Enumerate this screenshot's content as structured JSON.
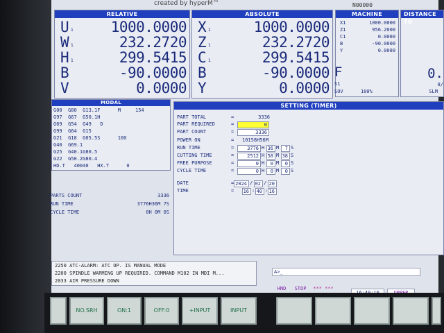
{
  "header": {
    "created_by": "created by hyperM™",
    "program_number": "N00000"
  },
  "relative": {
    "title": "RELATIVE",
    "axes": [
      {
        "axis": "U",
        "sub": "1",
        "value": "1000.0000"
      },
      {
        "axis": "W",
        "sub": "1",
        "value": "232.2720"
      },
      {
        "axis": "H",
        "sub": "1",
        "value": "299.5415"
      },
      {
        "axis": "B",
        "sub": "",
        "value": "-90.0000"
      },
      {
        "axis": "V",
        "sub": "",
        "value": "0.0000"
      }
    ]
  },
  "absolute": {
    "title": "ABSOLUTE",
    "axes": [
      {
        "axis": "X",
        "sub": "1",
        "value": "1000.0000"
      },
      {
        "axis": "Z",
        "sub": "1",
        "value": "232.2720"
      },
      {
        "axis": "C",
        "sub": "1",
        "value": "299.5415"
      },
      {
        "axis": "B",
        "sub": "",
        "value": "-90.0000"
      },
      {
        "axis": "Y",
        "sub": "",
        "value": "0.0000"
      }
    ]
  },
  "machine": {
    "title": "MACHINE",
    "rows": [
      {
        "axis": "X1",
        "value": "1000.0000"
      },
      {
        "axis": "Z1",
        "value": "956.2000"
      },
      {
        "axis": "C1",
        "value": "0.0000"
      },
      {
        "axis": "B",
        "value": "-90.0000"
      },
      {
        "axis": "Y",
        "value": "0.0000"
      }
    ],
    "feed_label": "F",
    "s1_label": "S1",
    "sov_label": "SOV",
    "sov_value": "100%"
  },
  "distance": {
    "title": "DISTANCE TO",
    "value": "0.",
    "sub": "8/",
    "slm": "SLM"
  },
  "modal": {
    "title": "MODAL",
    "lines": [
      "G00  G80  G13.1F      M     154",
      "G97  G67  G50.1H",
      "G69  G54  G49   D",
      "G99  G64  G15",
      "G21  G18  G05.5S      100",
      "G40  G69.1",
      "G25  G40.1G80.5",
      "G22  G50.2G80.4",
      "HD.T   40040   HX.T      0"
    ]
  },
  "summary": {
    "parts_count_label": "PARTS COUNT",
    "parts_count_value": "3336",
    "run_time_label": "RUN TIME",
    "run_time_value": "3776H36M 7S",
    "cycle_time_label": "CYCLE TIME",
    "cycle_time_value": "0H 0M 0S"
  },
  "setting": {
    "title": "SETTING (TIMER)",
    "part_total_label": "PART TOTAL",
    "part_total_value": "3336",
    "part_required_label": "PART REQUIRED",
    "part_required_value": "0",
    "part_count_label": "PART COUNT",
    "part_count_value": "3336",
    "power_on_label": "POWER ON",
    "power_on_value": "10158H56M",
    "run_time_label": "RUN TIME",
    "run_h": "3776",
    "run_m": "36",
    "run_s": "7",
    "cutting_time_label": "CUTTING TIME",
    "cut_h": "2512",
    "cut_m": "58",
    "cut_s": "38",
    "free_purpose_label": "FREE PURPOSE",
    "free_h": "0",
    "free_m": "0",
    "free_s": "0",
    "cycle_time_label": "CYCLE TIME",
    "cyc_h": "0",
    "cyc_m": "0",
    "cyc_s": "0",
    "date_label": "DATE",
    "date_y": "2024",
    "date_m": "02",
    "date_d": "20",
    "time_label": "TIME",
    "time_h": "16",
    "time_mi": "40",
    "time_s": "16",
    "unit_h": "H",
    "unit_m": "M",
    "unit_s": "S",
    "eq": "="
  },
  "alarms": [
    "2250 ATC-ALARM: ATC OP. IS MANUAL MODE",
    "2200 SPINDLE WARMING UP REQUIRED. COMMAND M102 IN MDI M...",
    "2033  AIR PRESSURE DOWN"
  ],
  "input_line": "A>_",
  "status_bar": {
    "mode": "HND",
    "state": "STOP",
    "stars": "*** ***",
    "clock": "16:40:16",
    "upper": "UPPER"
  },
  "softkeys": [
    "",
    "NO.SRH",
    "ON:1",
    "OFF:0",
    "+INPUT",
    "INPUT",
    "",
    "",
    "",
    "",
    ""
  ],
  "colors": {
    "panel_title": "#1f3fbf",
    "text": "#1a2a7a",
    "highlight": "#ffff33",
    "softkey_text": "#1f6e48"
  }
}
